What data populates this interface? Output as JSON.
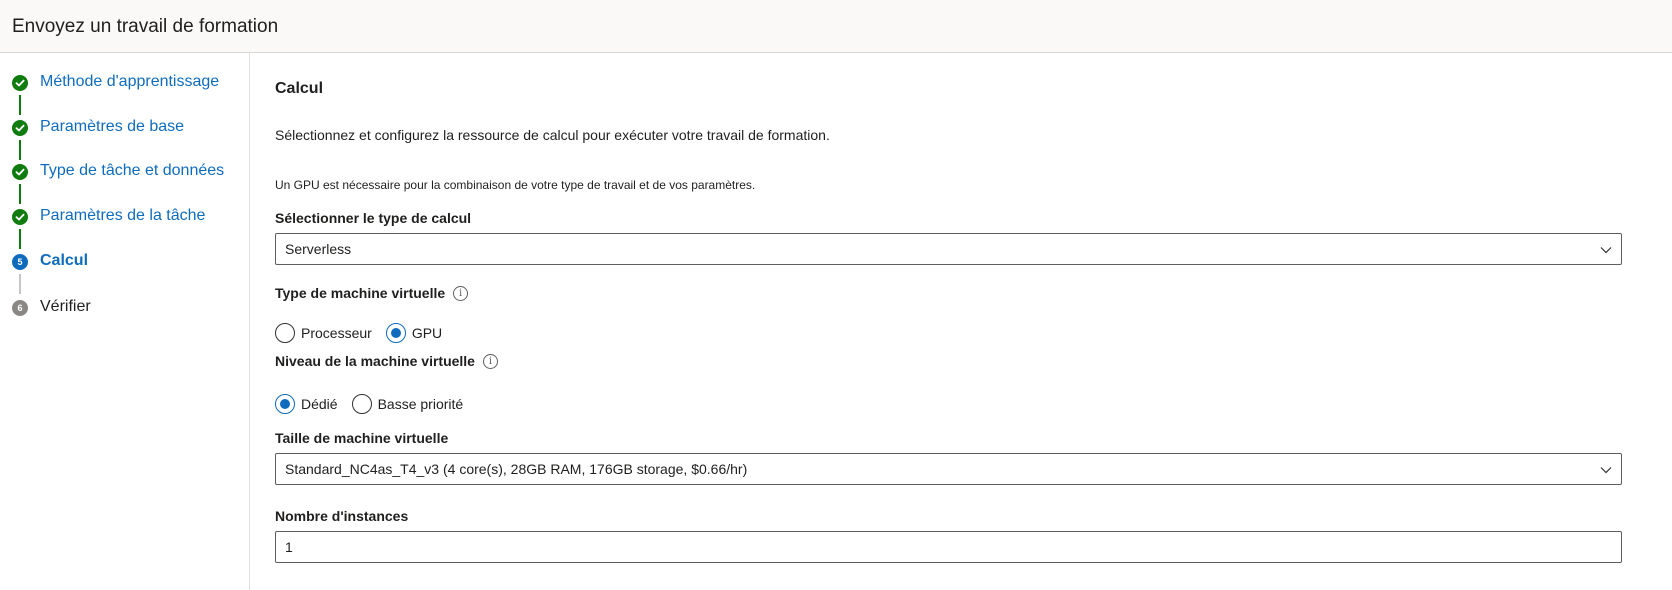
{
  "header": {
    "title": "Envoyez un travail de formation"
  },
  "steps": [
    {
      "number": "1",
      "label": "Méthode d'apprentissage",
      "status": "completed"
    },
    {
      "number": "2",
      "label": "Paramètres de base",
      "status": "completed"
    },
    {
      "number": "3",
      "label": "Type de tâche et données",
      "status": "completed"
    },
    {
      "number": "4",
      "label": "Paramètres de la tâche",
      "status": "completed"
    },
    {
      "number": "5",
      "label": "Calcul",
      "status": "current"
    },
    {
      "number": "6",
      "label": "Vérifier",
      "status": "pending"
    }
  ],
  "main": {
    "title": "Calcul",
    "description": "Sélectionnez et configurez la ressource de calcul pour exécuter votre travail de formation.",
    "gpu_note": "Un GPU est nécessaire pour la combinaison de votre type de travail et de vos paramètres.",
    "compute_type": {
      "label": "Sélectionner le type de calcul",
      "value": "Serverless"
    },
    "vm_type": {
      "label": "Type de machine virtuelle",
      "options": [
        {
          "label": "Processeur",
          "checked": false
        },
        {
          "label": "GPU",
          "checked": true
        }
      ]
    },
    "vm_priority": {
      "label": "Niveau de la machine virtuelle",
      "options": [
        {
          "label": "Dédié",
          "checked": true
        },
        {
          "label": "Basse priorité",
          "checked": false
        }
      ]
    },
    "vm_size": {
      "label": "Taille de machine virtuelle",
      "value": "Standard_NC4as_T4_v3 (4 core(s), 28GB RAM, 176GB storage, $0.66/hr)"
    },
    "instance_count": {
      "label": "Nombre d'instances",
      "value": "1"
    }
  },
  "colors": {
    "accent": "#0f6cbd",
    "success": "#107c10",
    "pending": "#8a8886"
  },
  "icons": {
    "completed_step": "checkmark-circle-icon",
    "info": "info-icon",
    "dropdown": "chevron-down-icon"
  }
}
